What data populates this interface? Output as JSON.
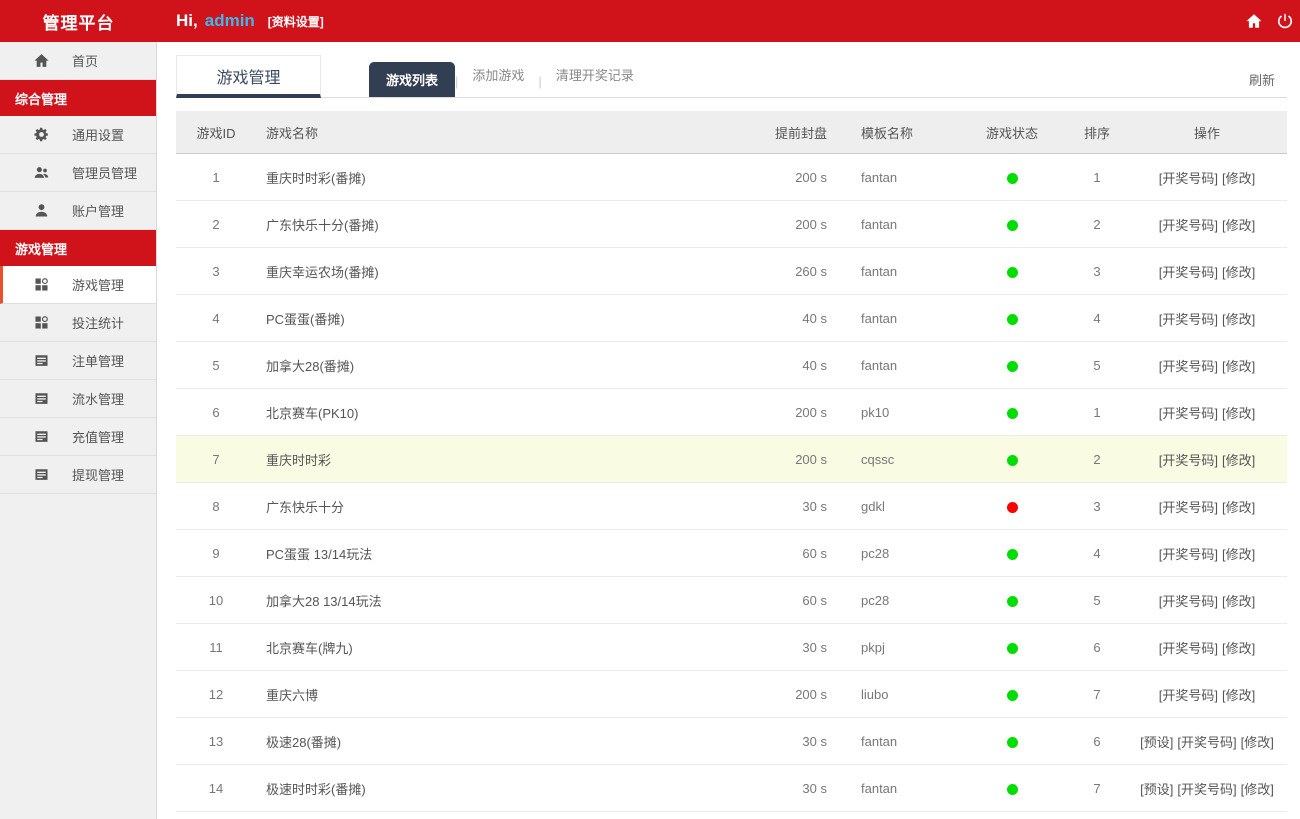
{
  "colors": {
    "brand_red": "#d0121b",
    "navy": "#323e52",
    "username_blue": "#3cb8ea",
    "status_on": "#00dd00",
    "status_off": "#ff0000",
    "highlight_row": "#fafbe3",
    "active_border": "#e8502a"
  },
  "header": {
    "brand": "管理平台",
    "greeting_prefix": "Hi,",
    "username": "admin",
    "profile_link": "[资料设置]"
  },
  "sidebar": {
    "items": [
      {
        "type": "item",
        "key": "home",
        "icon": "home",
        "label": "首页"
      },
      {
        "type": "section",
        "key": "general-management",
        "label": "综合管理"
      },
      {
        "type": "item",
        "key": "general-settings",
        "icon": "gear",
        "label": "通用设置"
      },
      {
        "type": "item",
        "key": "admin-management",
        "icon": "users",
        "label": "管理员管理"
      },
      {
        "type": "item",
        "key": "account-management",
        "icon": "user",
        "label": "账户管理"
      },
      {
        "type": "section",
        "key": "game-management",
        "label": "游戏管理"
      },
      {
        "type": "item",
        "key": "game-management",
        "icon": "grid",
        "label": "游戏管理",
        "active": true
      },
      {
        "type": "item",
        "key": "bet-statistics",
        "icon": "grid",
        "label": "投注统计"
      },
      {
        "type": "item",
        "key": "order-management",
        "icon": "list",
        "label": "注单管理"
      },
      {
        "type": "item",
        "key": "flow-management",
        "icon": "list",
        "label": "流水管理"
      },
      {
        "type": "item",
        "key": "recharge-management",
        "icon": "list",
        "label": "充值管理"
      },
      {
        "type": "item",
        "key": "withdraw-management",
        "icon": "list",
        "label": "提现管理"
      }
    ]
  },
  "content": {
    "page_tab": "游戏管理",
    "tabs": [
      {
        "key": "game-list",
        "label": "游戏列表",
        "active": true
      },
      {
        "key": "add-game",
        "label": "添加游戏"
      },
      {
        "key": "clear-draw-records",
        "label": "清理开奖记录"
      }
    ],
    "refresh_label": "刷新",
    "table": {
      "columns": [
        "游戏ID",
        "游戏名称",
        "提前封盘",
        "模板名称",
        "游戏状态",
        "排序",
        "操作"
      ],
      "rows": [
        {
          "id": "1",
          "name": "重庆时时彩(番摊)",
          "close": "200 s",
          "template": "fantan",
          "status": "on",
          "order": "1",
          "actions": [
            {
              "key": "draw-number",
              "label": "[开奖号码]"
            },
            {
              "key": "modify",
              "label": "[修改]"
            }
          ]
        },
        {
          "id": "2",
          "name": "广东快乐十分(番摊)",
          "close": "200 s",
          "template": "fantan",
          "status": "on",
          "order": "2",
          "actions": [
            {
              "key": "draw-number",
              "label": "[开奖号码]"
            },
            {
              "key": "modify",
              "label": "[修改]"
            }
          ]
        },
        {
          "id": "3",
          "name": "重庆幸运农场(番摊)",
          "close": "260 s",
          "template": "fantan",
          "status": "on",
          "order": "3",
          "actions": [
            {
              "key": "draw-number",
              "label": "[开奖号码]"
            },
            {
              "key": "modify",
              "label": "[修改]"
            }
          ]
        },
        {
          "id": "4",
          "name": "PC蛋蛋(番摊)",
          "close": "40 s",
          "template": "fantan",
          "status": "on",
          "order": "4",
          "actions": [
            {
              "key": "draw-number",
              "label": "[开奖号码]"
            },
            {
              "key": "modify",
              "label": "[修改]"
            }
          ]
        },
        {
          "id": "5",
          "name": "加拿大28(番摊)",
          "close": "40 s",
          "template": "fantan",
          "status": "on",
          "order": "5",
          "actions": [
            {
              "key": "draw-number",
              "label": "[开奖号码]"
            },
            {
              "key": "modify",
              "label": "[修改]"
            }
          ]
        },
        {
          "id": "6",
          "name": "北京赛车(PK10)",
          "close": "200 s",
          "template": "pk10",
          "status": "on",
          "order": "1",
          "actions": [
            {
              "key": "draw-number",
              "label": "[开奖号码]"
            },
            {
              "key": "modify",
              "label": "[修改]"
            }
          ]
        },
        {
          "id": "7",
          "name": "重庆时时彩",
          "close": "200 s",
          "template": "cqssc",
          "status": "on",
          "order": "2",
          "highlighted": true,
          "actions": [
            {
              "key": "draw-number",
              "label": "[开奖号码]"
            },
            {
              "key": "modify",
              "label": "[修改]"
            }
          ]
        },
        {
          "id": "8",
          "name": "广东快乐十分",
          "close": "30 s",
          "template": "gdkl",
          "status": "off",
          "order": "3",
          "actions": [
            {
              "key": "draw-number",
              "label": "[开奖号码]"
            },
            {
              "key": "modify",
              "label": "[修改]"
            }
          ]
        },
        {
          "id": "9",
          "name": "PC蛋蛋 13/14玩法",
          "close": "60 s",
          "template": "pc28",
          "status": "on",
          "order": "4",
          "actions": [
            {
              "key": "draw-number",
              "label": "[开奖号码]"
            },
            {
              "key": "modify",
              "label": "[修改]"
            }
          ]
        },
        {
          "id": "10",
          "name": "加拿大28 13/14玩法",
          "close": "60 s",
          "template": "pc28",
          "status": "on",
          "order": "5",
          "actions": [
            {
              "key": "draw-number",
              "label": "[开奖号码]"
            },
            {
              "key": "modify",
              "label": "[修改]"
            }
          ]
        },
        {
          "id": "11",
          "name": "北京赛车(牌九)",
          "close": "30 s",
          "template": "pkpj",
          "status": "on",
          "order": "6",
          "actions": [
            {
              "key": "draw-number",
              "label": "[开奖号码]"
            },
            {
              "key": "modify",
              "label": "[修改]"
            }
          ]
        },
        {
          "id": "12",
          "name": "重庆六博",
          "close": "200 s",
          "template": "liubo",
          "status": "on",
          "order": "7",
          "actions": [
            {
              "key": "draw-number",
              "label": "[开奖号码]"
            },
            {
              "key": "modify",
              "label": "[修改]"
            }
          ]
        },
        {
          "id": "13",
          "name": "极速28(番摊)",
          "close": "30 s",
          "template": "fantan",
          "status": "on",
          "order": "6",
          "actions": [
            {
              "key": "preset",
              "label": "[预设]"
            },
            {
              "key": "draw-number",
              "label": "[开奖号码]"
            },
            {
              "key": "modify",
              "label": "[修改]"
            }
          ]
        },
        {
          "id": "14",
          "name": "极速时时彩(番摊)",
          "close": "30 s",
          "template": "fantan",
          "status": "on",
          "order": "7",
          "actions": [
            {
              "key": "preset",
              "label": "[预设]"
            },
            {
              "key": "draw-number",
              "label": "[开奖号码]"
            },
            {
              "key": "modify",
              "label": "[修改]"
            }
          ]
        }
      ]
    }
  }
}
